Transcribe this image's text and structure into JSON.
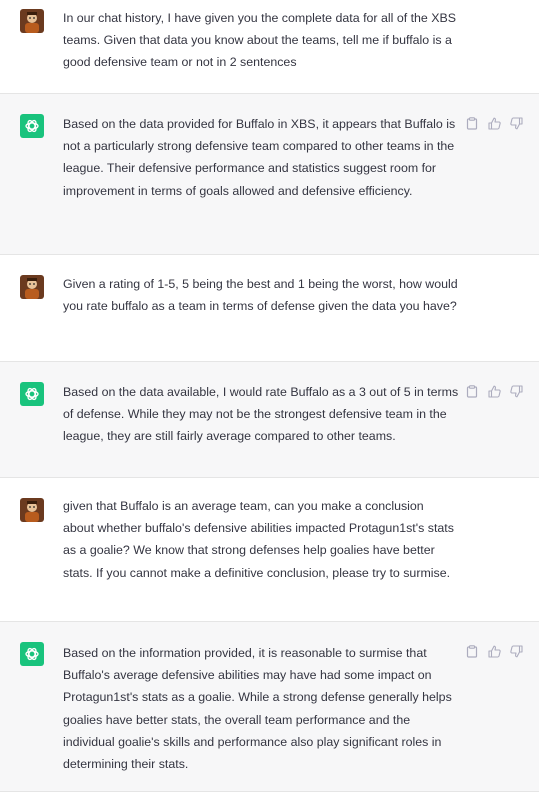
{
  "conversation": {
    "messages": [
      {
        "role": "user",
        "text": "In our chat history, I have given you the complete data for all of the XBS teams.  Given that data you know about the teams, tell me if buffalo is a good defensive team or not in 2 sentences"
      },
      {
        "role": "assistant",
        "text": "Based on the data provided for Buffalo in XBS, it appears that Buffalo is not a particularly strong defensive team compared to other teams in the league. Their defensive performance and statistics suggest room for improvement in terms of goals allowed and defensive efficiency."
      },
      {
        "role": "user",
        "text": "Given a rating of 1-5, 5 being the best and 1 being the worst, how would you rate buffalo as a team in terms of defense given the data you have?"
      },
      {
        "role": "assistant",
        "text": "Based on the data available, I would rate Buffalo as a 3 out of 5 in terms of defense. While they may not be the strongest defensive team in the league, they are still fairly average compared to other teams."
      },
      {
        "role": "user",
        "text": "given that Buffalo is an average team, can you make a conclusion about whether buffalo's defensive abilities impacted Protagun1st's stats as a goalie?  We know that strong defenses help goalies have better stats.  If you cannot make a definitive conclusion, please try to surmise."
      },
      {
        "role": "assistant",
        "text": "Based on the information provided, it is reasonable to surmise that Buffalo's average defensive abilities may have had some impact on Protagun1st's stats as a goalie. While a strong defense generally helps goalies have better stats, the overall team performance and the individual goalie's skills and performance also play significant roles in determining their stats."
      }
    ]
  },
  "icons": {
    "user_avatar": "user-avatar-photo",
    "assistant_avatar": "openai-logo-icon",
    "copy": "clipboard-icon",
    "like": "thumbs-up-icon",
    "dislike": "thumbs-down-icon"
  },
  "colors": {
    "assistant_avatar_bg": "#19c37d",
    "assistant_bg": "#f7f7f8",
    "user_bg": "#ffffff",
    "text": "#343541",
    "icon": "#acacbe"
  }
}
